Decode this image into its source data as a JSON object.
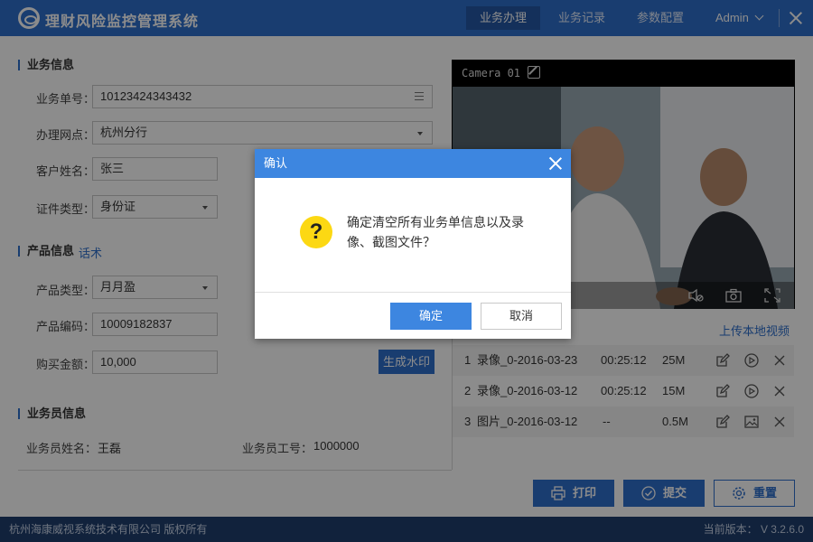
{
  "header": {
    "title": "理财风险监控管理系统",
    "nav": [
      "业务办理",
      "业务记录",
      "参数配置"
    ],
    "active_nav": "业务办理",
    "user": "Admin"
  },
  "business_info": {
    "section_title": "业务信息",
    "order_no_label": "业务单号：",
    "order_no_value": "10123424343432",
    "branch_label": "办理网点：",
    "branch_value": "杭州分行",
    "customer_name_label": "客户姓名：",
    "customer_name_value": "张三",
    "id_type_label": "证件类型：",
    "id_type_value": "身份证"
  },
  "product_info": {
    "section_title": "产品信息",
    "script_link": "话术",
    "type_label": "产品类型：",
    "type_value": "月月盈",
    "code_label": "产品编码：",
    "code_value": "10009182837",
    "amount_label": "购买金额：",
    "amount_value": "10,000",
    "watermark_button": "生成水印"
  },
  "agent_info": {
    "section_title": "业务员信息",
    "name_label": "业务员姓名：",
    "name_value": "王磊",
    "id_label": "业务员工号：",
    "id_value": "1000000"
  },
  "camera": {
    "title": "Camera 01",
    "upload_link": "上传本地视频"
  },
  "files": [
    {
      "index": "1",
      "name": "录像_0-2016-03-23",
      "duration": "00:25:12",
      "size": "25M",
      "kind": "video"
    },
    {
      "index": "2",
      "name": "录像_0-2016-03-12",
      "duration": "00:25:12",
      "size": "15M",
      "kind": "video"
    },
    {
      "index": "3",
      "name": "图片_0-2016-03-12",
      "duration": "--",
      "size": "0.5M",
      "kind": "image"
    }
  ],
  "actions": {
    "print": "打印",
    "submit": "提交",
    "reset": "重置"
  },
  "footer": {
    "copyright": "杭州海康威视系统技术有限公司 版权所有",
    "version": "当前版本： V 3.2.6.0"
  },
  "dialog": {
    "title": "确认",
    "message": "确定清空所有业务单信息以及录像、截图文件？",
    "ok": "确定",
    "cancel": "取消"
  },
  "colors": {
    "brand": "#2f6fcc",
    "dialog_header": "#3d86e0",
    "question_icon": "#fcd813",
    "footer": "#1f3f6e"
  }
}
